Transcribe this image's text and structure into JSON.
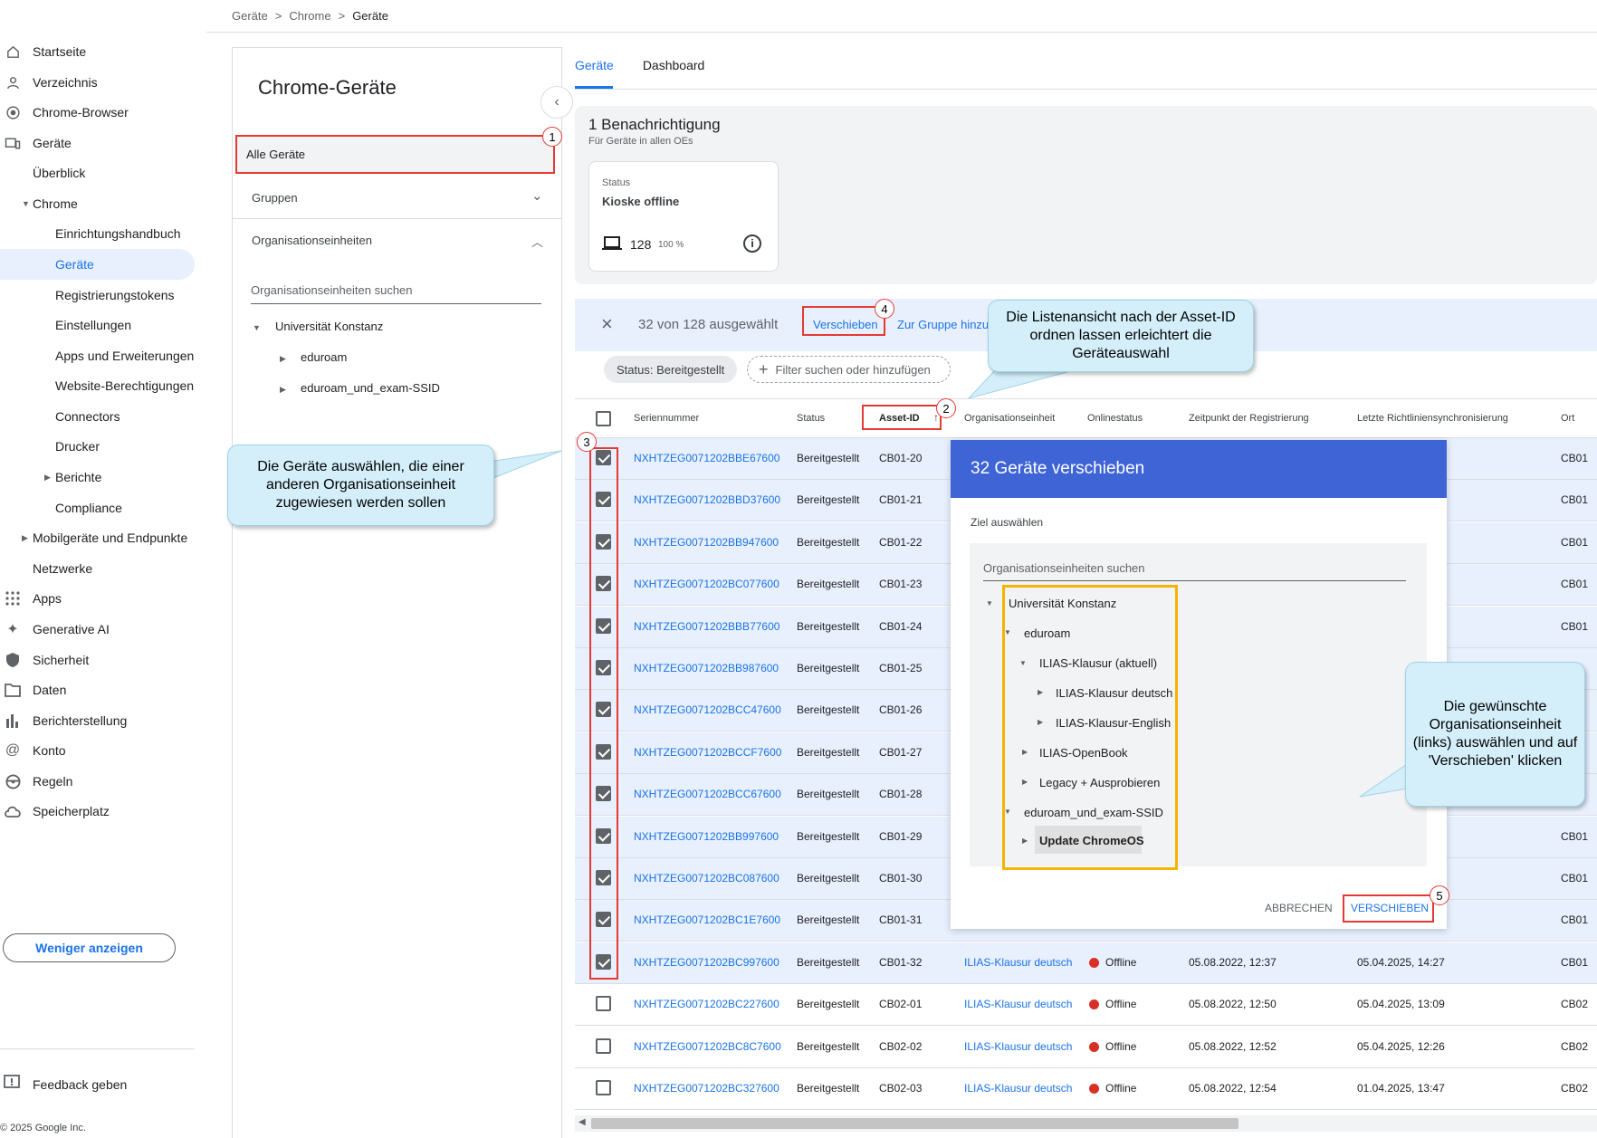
{
  "breadcrumb": [
    "Geräte",
    "Chrome",
    "Geräte"
  ],
  "breadcrumb_sep": ">",
  "sidebar": {
    "items": [
      {
        "label": "Startseite",
        "icon": "home-icon"
      },
      {
        "label": "Verzeichnis",
        "icon": "person-icon"
      },
      {
        "label": "Chrome-Browser",
        "icon": "chrome-icon"
      },
      {
        "label": "Geräte",
        "icon": "devices-icon"
      },
      {
        "label": "Überblick"
      },
      {
        "label": "Chrome"
      },
      {
        "label": "Einrichtungshandbuch"
      },
      {
        "label": "Geräte"
      },
      {
        "label": "Registrierungstokens"
      },
      {
        "label": "Einstellungen"
      },
      {
        "label": "Apps und Erweiterungen"
      },
      {
        "label": "Website-Berechtigungen"
      },
      {
        "label": "Connectors"
      },
      {
        "label": "Drucker"
      },
      {
        "label": "Berichte"
      },
      {
        "label": "Compliance"
      },
      {
        "label": "Mobilgeräte und Endpunkte"
      },
      {
        "label": "Netzwerke"
      },
      {
        "label": "Apps",
        "icon": "apps-grid-icon"
      },
      {
        "label": "Generative AI",
        "icon": "sparkle-icon"
      },
      {
        "label": "Sicherheit",
        "icon": "shield-icon"
      },
      {
        "label": "Daten",
        "icon": "data-folder-icon"
      },
      {
        "label": "Berichterstellung",
        "icon": "bar-chart-icon"
      },
      {
        "label": "Konto",
        "icon": "at-icon"
      },
      {
        "label": "Regeln",
        "icon": "steering-icon"
      },
      {
        "label": "Speicherplatz",
        "icon": "cloud-icon"
      }
    ],
    "less_button": "Weniger anzeigen",
    "feedback": "Feedback geben",
    "copyright": "© 2025 Google Inc."
  },
  "panel": {
    "title": "Chrome-Geräte",
    "all_devices": "Alle Geräte",
    "groups": "Gruppen",
    "org_units": "Organisationseinheiten",
    "search_placeholder": "Organisationseinheiten suchen",
    "tree": [
      "Universität Konstanz",
      "eduroam",
      "eduroam_und_exam-SSID"
    ]
  },
  "tabs": [
    "Geräte",
    "Dashboard"
  ],
  "notification": {
    "title": "1 Benachrichtigung",
    "subtitle": "Für Geräte in allen OEs",
    "card_label": "Status",
    "card_title": "Kioske offline",
    "count": "128",
    "percent": "100 %"
  },
  "selection": {
    "text": "32 von 128 ausgewählt",
    "move": "Verschieben",
    "add_group": "Zur Gruppe hinzu"
  },
  "filters": {
    "status_chip": "Status: Bereitgestellt",
    "add_filter": "Filter suchen oder hinzufügen"
  },
  "columns": [
    "Seriennummer",
    "Status",
    "Asset-ID",
    "Organisationseinheit",
    "Onlinestatus",
    "Zeitpunkt der Registrierung",
    "Letzte Richtliniensynchronisierung",
    "Ort"
  ],
  "rows": [
    {
      "serial": "NXHTZEG0071202BBE67600",
      "status": "Bereitgestellt",
      "asset": "CB01-20",
      "ou": "",
      "online": "",
      "reg": "",
      "sync": "",
      "loc": "CB01",
      "checked": true
    },
    {
      "serial": "NXHTZEG0071202BBD37600",
      "status": "Bereitgestellt",
      "asset": "CB01-21",
      "ou": "",
      "online": "",
      "reg": "",
      "sync": "",
      "loc": "CB01",
      "checked": true
    },
    {
      "serial": "NXHTZEG0071202BB947600",
      "status": "Bereitgestellt",
      "asset": "CB01-22",
      "ou": "",
      "online": "",
      "reg": "",
      "sync": "",
      "loc": "CB01",
      "checked": true
    },
    {
      "serial": "NXHTZEG0071202BC077600",
      "status": "Bereitgestellt",
      "asset": "CB01-23",
      "ou": "",
      "online": "",
      "reg": "",
      "sync": "",
      "loc": "CB01",
      "checked": true
    },
    {
      "serial": "NXHTZEG0071202BBB77600",
      "status": "Bereitgestellt",
      "asset": "CB01-24",
      "ou": "",
      "online": "",
      "reg": "",
      "sync": "",
      "loc": "CB01",
      "checked": true
    },
    {
      "serial": "NXHTZEG0071202BB987600",
      "status": "Bereitgestellt",
      "asset": "CB01-25",
      "ou": "",
      "online": "",
      "reg": "",
      "sync": "",
      "loc": "",
      "checked": true
    },
    {
      "serial": "NXHTZEG0071202BCC47600",
      "status": "Bereitgestellt",
      "asset": "CB01-26",
      "ou": "",
      "online": "",
      "reg": "",
      "sync": "",
      "loc": "",
      "checked": true
    },
    {
      "serial": "NXHTZEG0071202BCCF7600",
      "status": "Bereitgestellt",
      "asset": "CB01-27",
      "ou": "",
      "online": "",
      "reg": "",
      "sync": "",
      "loc": "",
      "checked": true
    },
    {
      "serial": "NXHTZEG0071202BCC67600",
      "status": "Bereitgestellt",
      "asset": "CB01-28",
      "ou": "",
      "online": "",
      "reg": "",
      "sync": "",
      "loc": "",
      "checked": true
    },
    {
      "serial": "NXHTZEG0071202BB997600",
      "status": "Bereitgestellt",
      "asset": "CB01-29",
      "ou": "",
      "online": "",
      "reg": "",
      "sync": "",
      "loc": "CB01",
      "checked": true
    },
    {
      "serial": "NXHTZEG0071202BC087600",
      "status": "Bereitgestellt",
      "asset": "CB01-30",
      "ou": "",
      "online": "",
      "reg": "",
      "sync": "",
      "loc": "CB01",
      "checked": true
    },
    {
      "serial": "NXHTZEG0071202BC1E7600",
      "status": "Bereitgestellt",
      "asset": "CB01-31",
      "ou": "",
      "online": "",
      "reg": "",
      "sync": "",
      "loc": "CB01",
      "checked": true
    },
    {
      "serial": "NXHTZEG0071202BC997600",
      "status": "Bereitgestellt",
      "asset": "CB01-32",
      "ou": "ILIAS-Klausur deutsch",
      "online": "Offline",
      "reg": "05.08.2022, 12:37",
      "sync": "05.04.2025, 14:27",
      "loc": "CB01",
      "checked": true
    },
    {
      "serial": "NXHTZEG0071202BC227600",
      "status": "Bereitgestellt",
      "asset": "CB02-01",
      "ou": "ILIAS-Klausur deutsch",
      "online": "Offline",
      "reg": "05.08.2022, 12:50",
      "sync": "05.04.2025, 13:09",
      "loc": "CB02",
      "checked": false
    },
    {
      "serial": "NXHTZEG0071202BC8C7600",
      "status": "Bereitgestellt",
      "asset": "CB02-02",
      "ou": "ILIAS-Klausur deutsch",
      "online": "Offline",
      "reg": "05.08.2022, 12:52",
      "sync": "05.04.2025, 12:26",
      "loc": "CB02",
      "checked": false
    },
    {
      "serial": "NXHTZEG0071202BC327600",
      "status": "Bereitgestellt",
      "asset": "CB02-03",
      "ou": "ILIAS-Klausur deutsch",
      "online": "Offline",
      "reg": "05.08.2022, 12:54",
      "sync": "01.04.2025, 13:47",
      "loc": "CB02",
      "checked": false
    }
  ],
  "dialog": {
    "title": "32 Geräte verschieben",
    "target_label": "Ziel auswählen",
    "search_placeholder": "Organisationseinheiten suchen",
    "tree": [
      "Universität Konstanz",
      "eduroam",
      "ILIAS-Klausur (aktuell)",
      "ILIAS-Klausur deutsch",
      "ILIAS-Klausur-English",
      "ILIAS-OpenBook",
      "Legacy + Ausprobieren",
      "eduroam_und_exam-SSID",
      "Update ChromeOS"
    ],
    "cancel": "ABBRECHEN",
    "confirm": "VERSCHIEBEN"
  },
  "callouts": {
    "select_devices": "Die Geräte auswählen, die einer anderen Organisationseinheit zugewiesen werden sollen",
    "sort_asset": "Die Listenansicht nach der Asset-ID ordnen lassen erleichtert die Geräteauswahl",
    "choose_ou": "Die gewünschte Organisationseinheit (links) auswählen und auf 'Verschieben' klicken"
  },
  "markers": [
    "1",
    "2",
    "3",
    "4",
    "5"
  ],
  "colors": {
    "accent": "#1a73e8",
    "annotation_red": "#e53935",
    "annotation_yellow": "#f4b400",
    "dialog_header": "#3e64d6",
    "callout_bg": "#d4effa"
  }
}
